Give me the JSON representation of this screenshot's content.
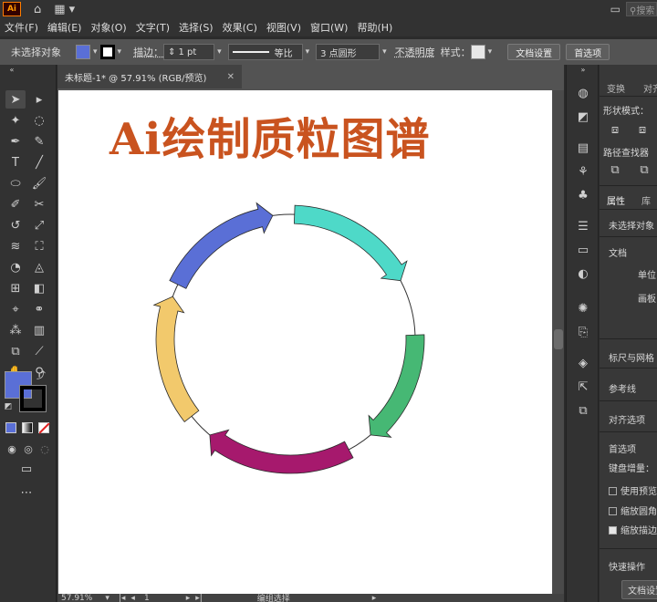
{
  "app": {
    "logo": "Ai",
    "search_placeholder": "搜索"
  },
  "menu": [
    "文件(F)",
    "编辑(E)",
    "对象(O)",
    "文字(T)",
    "选择(S)",
    "效果(C)",
    "视图(V)",
    "窗口(W)",
    "帮助(H)"
  ],
  "control": {
    "selection": "未选择对象",
    "fill_color": "#5a6fd6",
    "stroke_label": "描边：",
    "stroke_weight": "1 pt",
    "profile": "等比",
    "brush": "3 点圆形",
    "opacity_label": "不透明度",
    "style_label": "样式：",
    "doc_setup": "文档设置",
    "prefs": "首选项"
  },
  "document": {
    "tab": "未标题-1* @ 57.91% (RGB/预览)",
    "title_text": "Ai绘制质粒图谱",
    "title_color": "#c9531f",
    "segments": [
      {
        "color": "#4ed9c8"
      },
      {
        "color": "#46b874"
      },
      {
        "color": "#a6196d"
      },
      {
        "color": "#f2c96c"
      },
      {
        "color": "#5a6fd6"
      }
    ]
  },
  "status": {
    "zoom": "57.91%",
    "page": "1",
    "mode": "编组选择"
  },
  "panel": {
    "tabs": [
      "变换",
      "对齐"
    ],
    "shape_mode": "形状模式：",
    "pathfinder": "路径查找器",
    "tab_properties": "属性",
    "tab_library": "库",
    "no_selection": "未选择对象",
    "document_label": "文档",
    "units_label": "单位",
    "artboard_label": "画板",
    "rulers_grids": "标尺与网格",
    "guides": "参考线",
    "snap_options": "对齐选项",
    "preferences": "首选项",
    "keyboard_increment": "键盘增量：",
    "chk_preview": "使用预览边界",
    "chk_scale_corners": "缩放圆角",
    "chk_scale_strokes": "缩放描边和效果",
    "quick_actions": "快速操作",
    "doc_setup_btn": "文档设置"
  }
}
